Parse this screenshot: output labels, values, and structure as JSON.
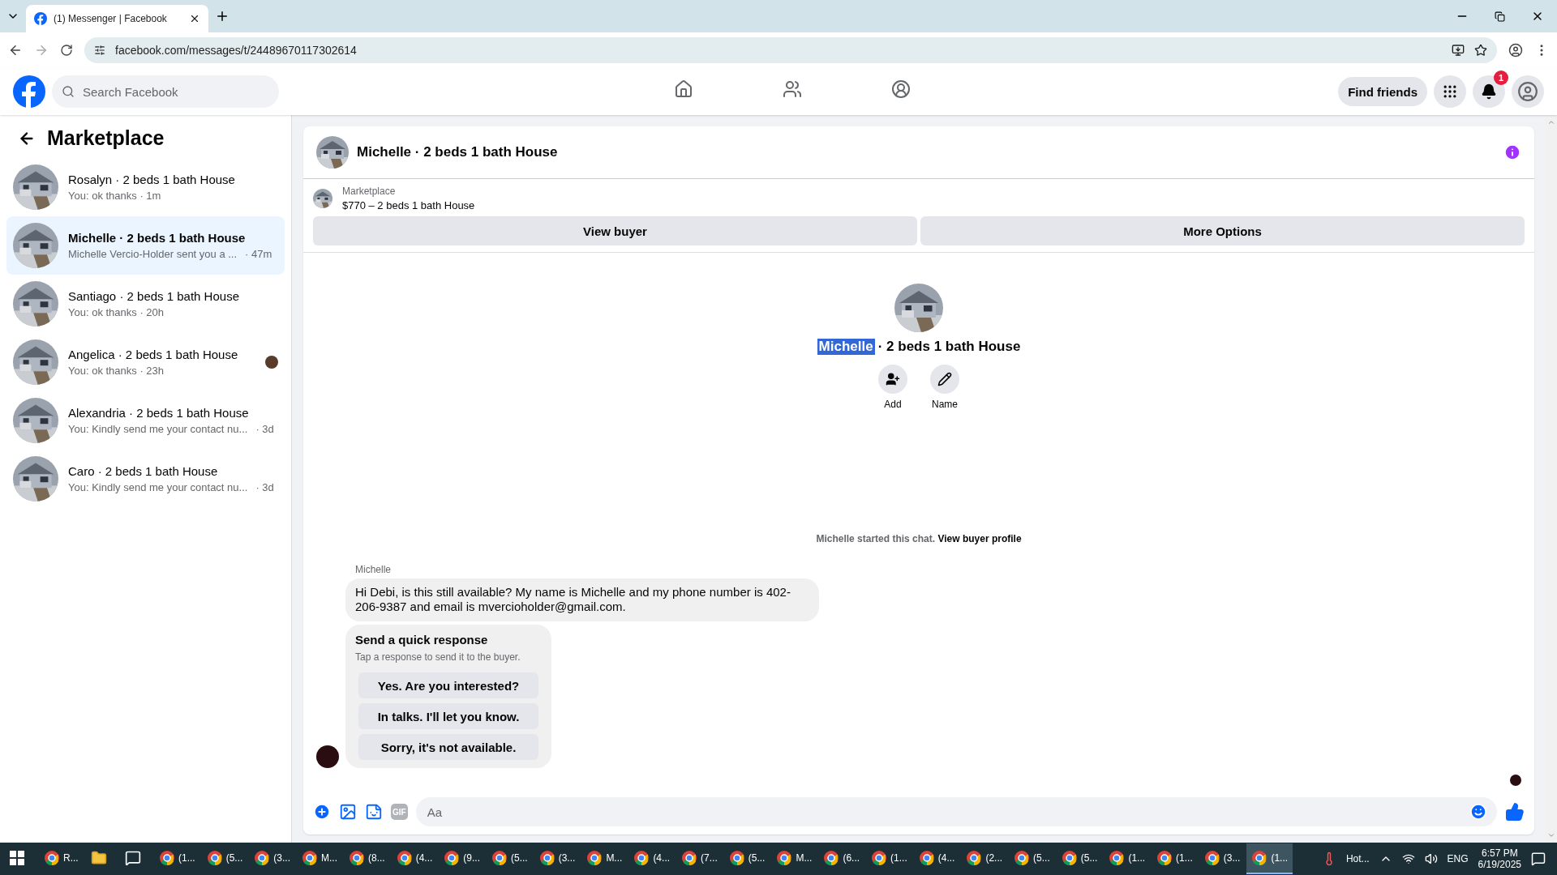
{
  "browser": {
    "tab_title": "(1) Messenger | Facebook",
    "url": "facebook.com/messages/t/24489670117302614"
  },
  "header": {
    "search_placeholder": "Search Facebook",
    "nav": [
      {
        "kind": "home",
        "selected": false
      },
      {
        "kind": "friends",
        "selected": false
      },
      {
        "kind": "groups",
        "selected": false
      }
    ],
    "find_friends": "Find friends",
    "notification_count": "1"
  },
  "sidebar": {
    "title": "Marketplace",
    "conversations": [
      {
        "title": "Rosalyn · 2 beds 1 bath House",
        "preview": "You: ok thanks · 1m",
        "selected": false,
        "seen": false
      },
      {
        "title": "Michelle · 2 beds 1 bath House",
        "preview": "Michelle Vercio-Holder sent you a ...",
        "time": "· 47m",
        "selected": true,
        "seen": false
      },
      {
        "title": "Santiago · 2 beds 1 bath House",
        "preview": "You: ok thanks · 20h",
        "selected": false,
        "seen": false
      },
      {
        "title": "Angelica · 2 beds 1 bath House",
        "preview": "You: ok thanks · 23h",
        "selected": false,
        "seen": true
      },
      {
        "title": "Alexandria · 2 beds 1 bath House",
        "preview": "You: Kindly send me your contact nu...",
        "time": "· 3d",
        "selected": false,
        "seen": false
      },
      {
        "title": "Caro · 2 beds 1 bath House",
        "preview": "You: Kindly send me your contact nu...",
        "time": "· 3d",
        "selected": false,
        "seen": false
      }
    ]
  },
  "chat": {
    "title": "Michelle · 2 beds 1 bath House",
    "listing": {
      "label": "Marketplace",
      "summary": "$770 – 2 beds 1 bath House"
    },
    "actions": [
      "View buyer",
      "More Options"
    ],
    "profile": {
      "name": "Michelle",
      "name_highlighted": true,
      "rest": "· 2 beds 1 bath House",
      "buttons": [
        {
          "kind": "add",
          "label": "Add"
        },
        {
          "kind": "edit",
          "label": "Name"
        }
      ]
    },
    "started": {
      "text": "Michelle started this chat.",
      "link": "View buyer profile"
    },
    "sender": "Michelle",
    "message": "Hi Debi, is this still available? My name is Michelle and my phone number is 402-206-9387 and email is mvercioholder@gmail.com.",
    "quick": {
      "title": "Send a quick response",
      "hint": "Tap a response to send it to the buyer.",
      "options": [
        "Yes. Are you interested?",
        "In talks. I'll let you know.",
        "Sorry, it's not available."
      ]
    },
    "composer": {
      "placeholder": "Aa",
      "gif_label": "GIF"
    }
  },
  "taskbar": {
    "apps": [
      {
        "kind": "chrome",
        "label": "R...",
        "active": false
      },
      {
        "kind": "folder",
        "active": false
      },
      {
        "kind": "app",
        "active": false
      },
      {
        "kind": "chrome",
        "label": "(1...",
        "active": false
      },
      {
        "kind": "chrome",
        "label": "(5...",
        "active": false
      },
      {
        "kind": "chrome",
        "label": "(3...",
        "active": false
      },
      {
        "kind": "chrome",
        "label": "M...",
        "active": false
      },
      {
        "kind": "chrome",
        "label": "(8...",
        "active": false
      },
      {
        "kind": "chrome",
        "label": "(4...",
        "active": false
      },
      {
        "kind": "chrome",
        "label": "(9...",
        "active": false
      },
      {
        "kind": "chrome",
        "label": "(5...",
        "active": false
      },
      {
        "kind": "chrome",
        "label": "(3...",
        "active": false
      },
      {
        "kind": "chrome",
        "label": "M...",
        "active": false
      },
      {
        "kind": "chrome",
        "label": "(4...",
        "active": false
      },
      {
        "kind": "chrome",
        "label": "(7...",
        "active": false
      },
      {
        "kind": "chrome",
        "label": "(5...",
        "active": false
      },
      {
        "kind": "chrome",
        "label": "M...",
        "active": false
      },
      {
        "kind": "chrome",
        "label": "(6...",
        "active": false
      },
      {
        "kind": "chrome",
        "label": "(1...",
        "active": false
      },
      {
        "kind": "chrome",
        "label": "(4...",
        "active": false
      },
      {
        "kind": "chrome",
        "label": "(2...",
        "active": false
      },
      {
        "kind": "chrome",
        "label": "(5...",
        "active": false
      },
      {
        "kind": "chrome",
        "label": "(5...",
        "active": false
      },
      {
        "kind": "chrome",
        "label": "(1...",
        "active": false
      },
      {
        "kind": "chrome",
        "label": "(1...",
        "active": false
      },
      {
        "kind": "chrome",
        "label": "(3...",
        "active": false
      },
      {
        "kind": "chrome",
        "label": "(1...",
        "active": true
      }
    ],
    "weather": "Hot...",
    "language": "ENG",
    "time": "6:57 PM",
    "date": "6/19/2025"
  }
}
